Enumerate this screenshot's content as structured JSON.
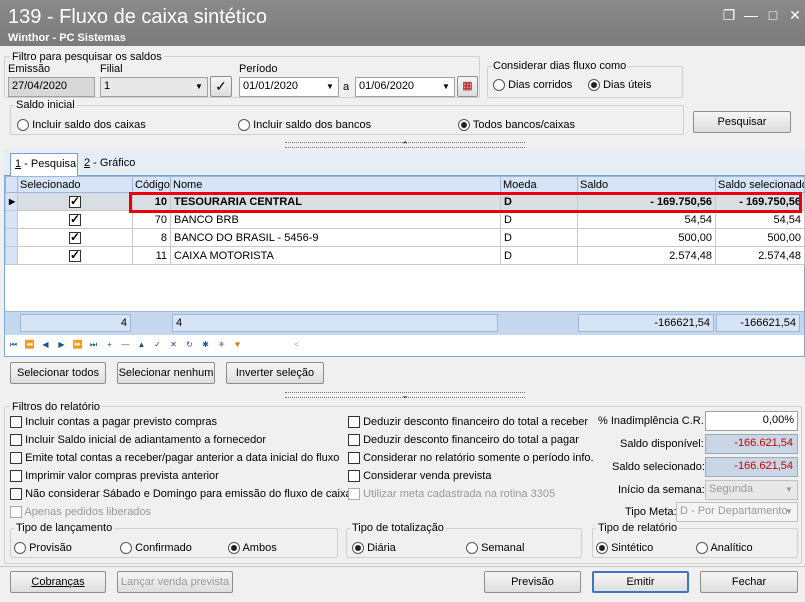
{
  "window": {
    "title": "139 - Fluxo de caixa sintético",
    "subtitle": "Winthor - PC Sistemas",
    "btn_restore": "❐",
    "btn_min": "—",
    "btn_close": "✕"
  },
  "filtro": {
    "group_title": "Filtro para pesquisar os saldos",
    "emissao_label": "Emissão",
    "emissao_value": "27/04/2020",
    "filial_label": "Filial",
    "filial_value": "1",
    "periodo_label": "Período",
    "periodo_from": "01/01/2020",
    "periodo_sep": "a",
    "periodo_to": "01/06/2020",
    "dias_title": "Considerar dias fluxo como",
    "dias_corridos": "Dias corridos",
    "dias_uteis": "Dias úteis",
    "saldo_title": "Saldo inicial",
    "saldo_caixas": "Incluir saldo dos caixas",
    "saldo_bancos": "Incluir saldo dos bancos",
    "saldo_todos": "Todos bancos/caixas",
    "pesquisar": "Pesquisar"
  },
  "tabs": {
    "pesquisa_num": "1",
    "pesquisa": " - Pesquisa",
    "grafico_num": "2",
    "grafico": " - Gráfico"
  },
  "grid": {
    "headers": [
      "Selecionado",
      "Código",
      "Nome",
      "Moeda",
      "Saldo",
      "Saldo selecionado"
    ],
    "rows": [
      {
        "selected": true,
        "codigo": "10",
        "nome": "TESOURARIA CENTRAL",
        "moeda": "D",
        "saldo": "- 169.750,56",
        "saldo_sel": "- 169.750,56"
      },
      {
        "selected": true,
        "codigo": "70",
        "nome": "BANCO BRB",
        "moeda": "D",
        "saldo": "54,54",
        "saldo_sel": "54,54"
      },
      {
        "selected": true,
        "codigo": "8",
        "nome": "BANCO DO BRASIL - 5456-9",
        "moeda": "D",
        "saldo": "500,00",
        "saldo_sel": "500,00"
      },
      {
        "selected": true,
        "codigo": "11",
        "nome": "CAIXA MOTORISTA",
        "moeda": "D",
        "saldo": "2.574,48",
        "saldo_sel": "2.574,48"
      }
    ],
    "footer": {
      "count1": "4",
      "count2": "4",
      "saldo_total": "-166621,54",
      "saldo_sel_total": "-166621,54"
    }
  },
  "selection_buttons": {
    "todos": "Selecionar todos",
    "nenhum": "Selecionar nenhum",
    "inverter": "Inverter seleção"
  },
  "filtros_rel": {
    "title": "Filtros do relatório",
    "col1": [
      "Incluir contas a pagar previsto compras",
      "Incluir Saldo inicial de adiantamento a fornecedor",
      "Emite total contas a receber/pagar anterior a data inicial do fluxo",
      "Imprimir valor compras prevista anterior",
      "Não considerar Sábado e Domingo para emissão do fluxo de caixa",
      "Apenas pedidos liberados"
    ],
    "col2": [
      "Deduzir desconto financeiro do total a receber",
      "Deduzir desconto financeiro do total a pagar",
      "Considerar no relatório somente o período info.",
      "Considerar venda prevista",
      "Utilizar meta cadastrada na rotina 3305"
    ],
    "inadimplencia_label": "% Inadimplência C.R.",
    "inadimplencia_value": "0,00%",
    "saldo_disp_label": "Saldo disponível:",
    "saldo_disp_value": "-166.621,54",
    "saldo_sel_label": "Saldo selecionado:",
    "saldo_sel_value": "-166.621,54",
    "inicio_semana_label": "Início da semana:",
    "inicio_semana_value": "Segunda",
    "tipo_meta_label": "Tipo Meta:",
    "tipo_meta_value": "D - Por Departamento"
  },
  "lancamento": {
    "title": "Tipo de lançamento",
    "provisao": "Provisão",
    "confirmado": "Confirmado",
    "ambos": "Ambos"
  },
  "totalizacao": {
    "title": "Tipo de totalização",
    "diaria": "Diária",
    "semanal": "Semanal"
  },
  "relatorio": {
    "title": "Tipo de relatório",
    "sintetico": "Sintético",
    "analitico": "Analítico"
  },
  "bottom": {
    "cobrancas": "Cobranças",
    "lancar": "Lançar venda prevista",
    "previsao": "Previsão",
    "emitir": "Emitir",
    "fechar": "Fechar"
  },
  "colors": {
    "highlight": "#e8000b",
    "title_bg": "#7f7f7f",
    "grid_header": "#d6e4f5"
  }
}
